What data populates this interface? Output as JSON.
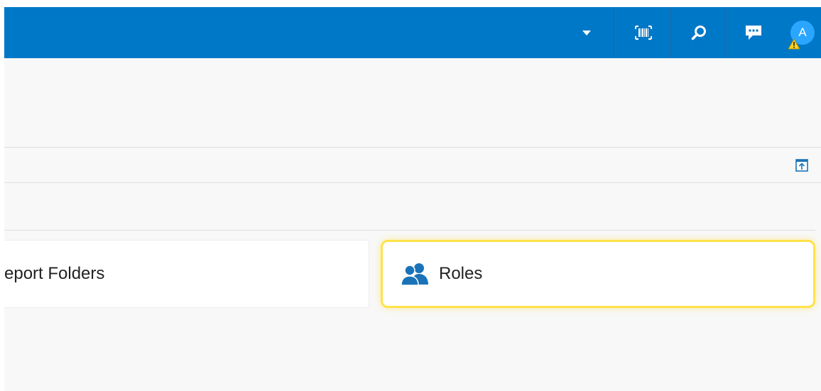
{
  "header": {
    "avatar_initial": "A",
    "icons": {
      "dropdown": "caret-down-icon",
      "barcode": "barcode-scan-icon",
      "search": "search-icon",
      "chat": "chat-icon",
      "warning": "warning-icon"
    },
    "background_color": "#0078c8",
    "avatar_color": "#2aa6ff"
  },
  "toolbar": {
    "expand_icon": "expand-panel-icon"
  },
  "cards": [
    {
      "label": "eport Folders"
    },
    {
      "label": "Roles",
      "icon": "users-icon",
      "highlighted": true
    }
  ],
  "colors": {
    "page_background": "#f8f8f8",
    "highlight": "#ffe24a",
    "accent": "#0078c8"
  }
}
